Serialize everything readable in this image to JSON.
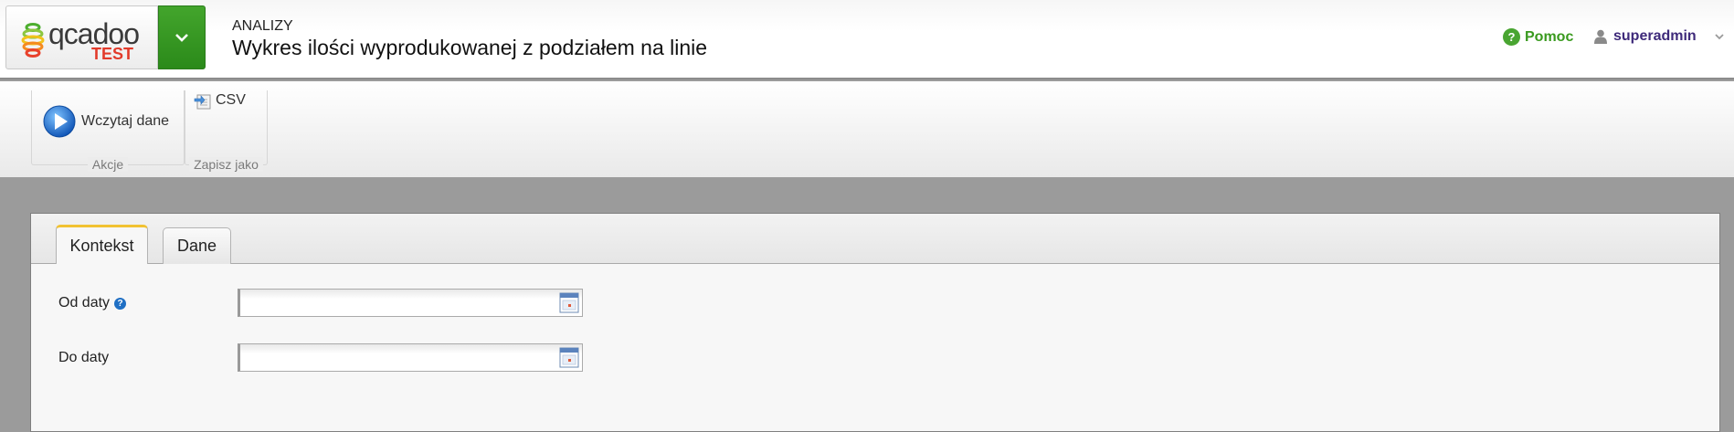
{
  "header": {
    "logo_text": "qcadoo",
    "logo_env": "TEST",
    "category": "ANALIZY",
    "title": "Wykres ilości wyprodukowanej z podziałem na linie",
    "help_label": "Pomoc",
    "user_label": "superadmin"
  },
  "ribbon": {
    "groups": [
      {
        "label": "Akcje",
        "button": {
          "label": "Wczytaj dane",
          "icon": "play-icon"
        }
      },
      {
        "label": "Zapisz jako",
        "button": {
          "label": "CSV",
          "icon": "csv-export-icon"
        }
      }
    ]
  },
  "tabs": [
    {
      "label": "Kontekst",
      "active": true
    },
    {
      "label": "Dane",
      "active": false
    }
  ],
  "form": {
    "from_date": {
      "label": "Od daty",
      "value": ""
    },
    "to_date": {
      "label": "Do daty",
      "value": ""
    }
  },
  "colors": {
    "accent_green": "#3a9a1f",
    "tab_highlight": "#f1c232",
    "user_text": "#3e2a7a"
  }
}
